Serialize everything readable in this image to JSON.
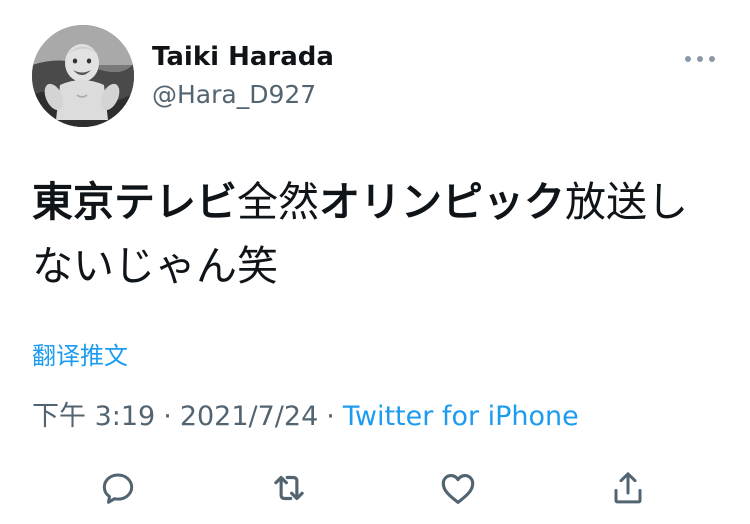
{
  "user": {
    "display_name": "Taiki Harada",
    "handle": "@Hara_D927",
    "avatar": "baby-photo-avatar"
  },
  "tweet": {
    "segments": [
      {
        "text": "東京テレビ",
        "bold": true
      },
      {
        "text": "全然",
        "bold": false
      },
      {
        "text": "オリンピック",
        "bold": true
      },
      {
        "text": "放送しないじゃん笑",
        "bold": false
      }
    ],
    "translate_label": "翻译推文",
    "time": "下午 3:19",
    "separator": "·",
    "date": "2021/7/24",
    "source": "Twitter for iPhone"
  },
  "icons": {
    "more": "more-horizontal-icon",
    "reply": "reply-icon",
    "retweet": "retweet-icon",
    "like": "like-icon",
    "share": "share-icon"
  },
  "colors": {
    "text": "#0f1419",
    "secondary": "#536471",
    "accent": "#1d9bf0"
  }
}
